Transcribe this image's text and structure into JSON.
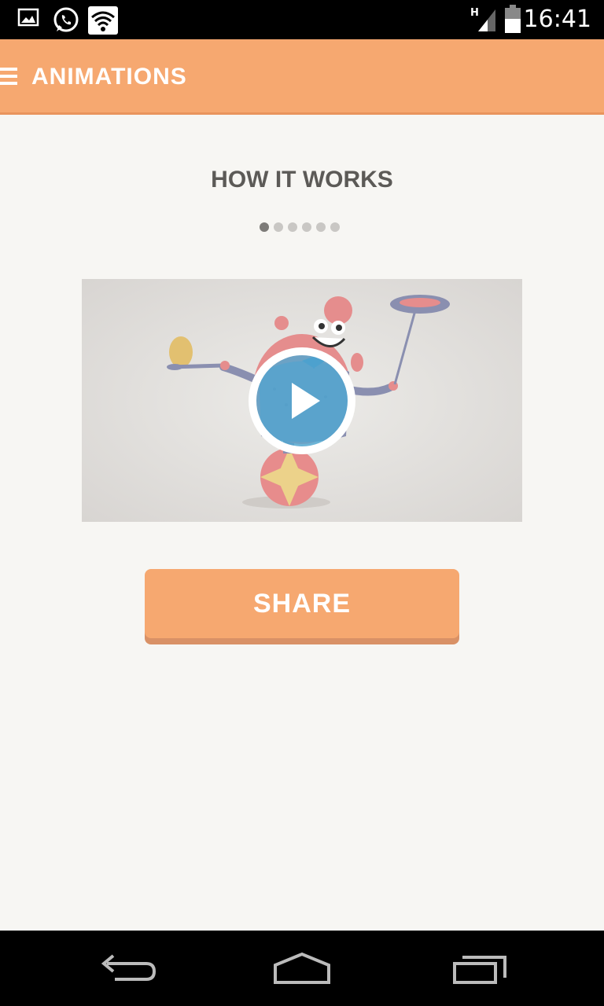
{
  "status_bar": {
    "time": "16:41",
    "icons": [
      "gallery-icon",
      "whatsapp-icon",
      "wifi-icon",
      "signal-icon",
      "battery-icon"
    ],
    "network_type": "H"
  },
  "app_bar": {
    "title": "ANIMATIONS",
    "menu_icon": "hamburger-menu-icon",
    "background_color": "#f6a870"
  },
  "content": {
    "section_title": "HOW IT WORKS",
    "pagination": {
      "total": 6,
      "current": 1
    },
    "video": {
      "play_icon": "play-icon"
    },
    "share_label": "SHARE"
  },
  "nav_bar": {
    "icons": [
      "back-icon",
      "home-icon",
      "recents-icon"
    ]
  },
  "colors": {
    "accent": "#f6a870",
    "accent_shadow": "#d99166",
    "background": "#f7f6f3",
    "title_text": "#5c5a57",
    "play_blue": "#4ea8d3"
  }
}
